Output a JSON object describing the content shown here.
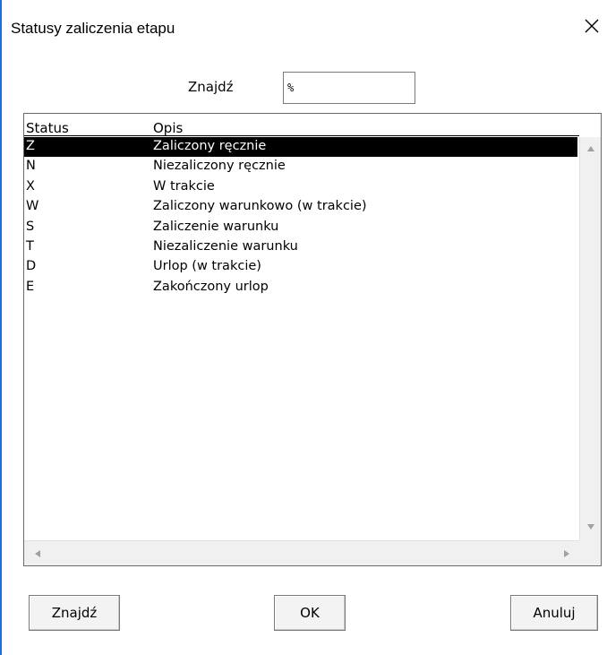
{
  "window": {
    "title": "Statusy zaliczenia etapu",
    "close_icon": "close-icon"
  },
  "search": {
    "label": "Znajdź",
    "value": "%"
  },
  "table": {
    "headers": [
      "Status",
      "Opis"
    ],
    "rows": [
      {
        "status": "Z",
        "opis": "Zaliczony ręcznie",
        "selected": true
      },
      {
        "status": "N",
        "opis": "Niezaliczony ręcznie"
      },
      {
        "status": "X",
        "opis": "W trakcie"
      },
      {
        "status": "W",
        "opis": "Zaliczony warunkowo (w trakcie)"
      },
      {
        "status": "S",
        "opis": "Zaliczenie warunku"
      },
      {
        "status": "T",
        "opis": "Niezaliczenie warunku"
      },
      {
        "status": "D",
        "opis": "Urlop (w trakcie)"
      },
      {
        "status": "E",
        "opis": "Zakończony urlop"
      }
    ]
  },
  "buttons": {
    "find": "Znajdź",
    "ok": "OK",
    "cancel": "Anuluj"
  },
  "colors": {
    "selection": "#000000",
    "border_accent": "#1e6fd6",
    "button_face": "#f3f3f3"
  }
}
